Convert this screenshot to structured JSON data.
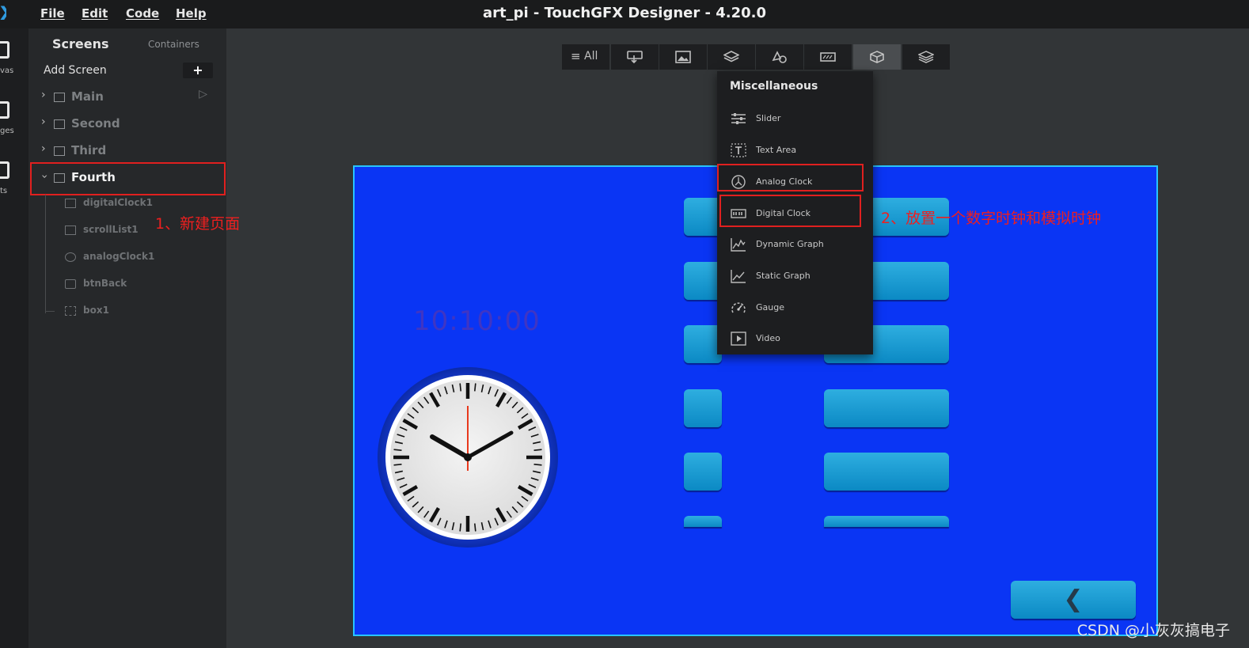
{
  "app": {
    "title": "art_pi - TouchGFX Designer - 4.20.0",
    "menu": [
      "File",
      "Edit",
      "Code",
      "Help"
    ]
  },
  "navrail": {
    "labels": [
      "vas",
      "ges",
      "ts"
    ]
  },
  "screens_panel": {
    "title": "Screens",
    "containers_tab": "Containers",
    "add_screen": "Add Screen",
    "add_symbol": "+",
    "screens": [
      "Main",
      "Second",
      "Third",
      "Fourth"
    ],
    "widgets": [
      "digitalClock1",
      "scrollList1",
      "analogClock1",
      "btnBack",
      "box1"
    ]
  },
  "toolbar": {
    "all_label": "All",
    "active_index": 6
  },
  "dropdown": {
    "title": "Miscellaneous",
    "items": [
      "Slider",
      "Text Area",
      "Analog Clock",
      "Digital Clock",
      "Dynamic Graph",
      "Static Graph",
      "Gauge",
      "Video"
    ]
  },
  "canvas": {
    "digital_clock_text": "10:10:00",
    "back_button_glyph": "❮",
    "background_color": "#0a35f4"
  },
  "annotations": {
    "step1": "1、新建页面",
    "step2": "2、放置一个数字时钟和模拟时钟"
  },
  "watermark": "CSDN @小灰灰搞电子"
}
